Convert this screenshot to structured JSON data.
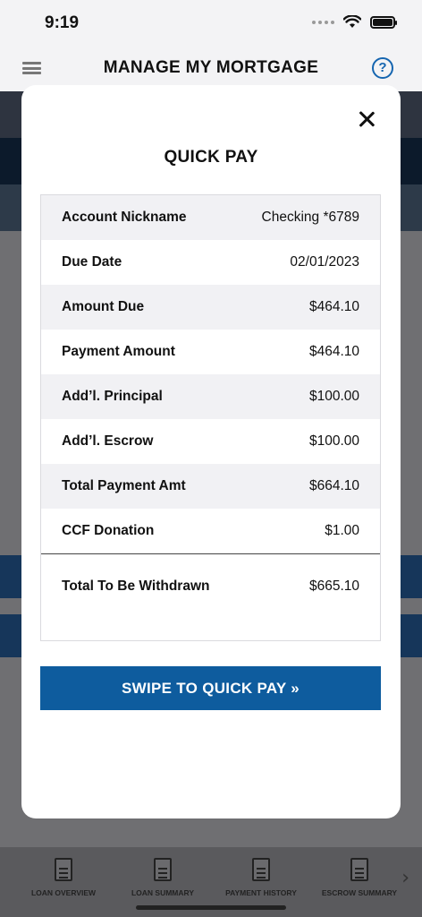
{
  "status_bar": {
    "time": "9:19"
  },
  "header": {
    "title": "MANAGE MY MORTGAGE",
    "help_symbol": "?"
  },
  "modal": {
    "title": "QUICK PAY",
    "rows": [
      {
        "label": "Account Nickname",
        "value": "Checking *6789"
      },
      {
        "label": "Due Date",
        "value": "02/01/2023"
      },
      {
        "label": "Amount Due",
        "value": "$464.10"
      },
      {
        "label": "Payment Amount",
        "value": "$464.10"
      },
      {
        "label": "Add’l. Principal",
        "value": "$100.00"
      },
      {
        "label": "Add’l. Escrow",
        "value": "$100.00"
      },
      {
        "label": "Total Payment Amt",
        "value": "$664.10"
      },
      {
        "label": "CCF Donation",
        "value": "$1.00"
      }
    ],
    "total": {
      "label": "Total To Be Withdrawn",
      "value": "$665.10"
    },
    "swipe_label": "SWIPE TO QUICK PAY »"
  },
  "tab_bar": {
    "tabs": [
      {
        "label": "LOAN OVERVIEW",
        "icon": "document-icon"
      },
      {
        "label": "LOAN SUMMARY",
        "icon": "document-clock-icon"
      },
      {
        "label": "PAYMENT HISTORY",
        "icon": "document-chart-icon"
      },
      {
        "label": "ESCROW SUMMARY",
        "icon": "document-dollar-icon"
      }
    ]
  },
  "colors": {
    "accent": "#0e5c9e",
    "help": "#1565b0"
  }
}
